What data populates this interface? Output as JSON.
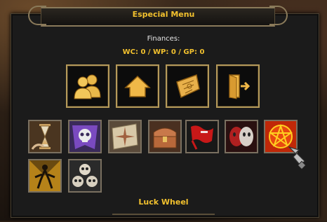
{
  "window": {
    "title": "Especial Menu"
  },
  "finances": {
    "label": "Finances:",
    "values": "WC: 0 / WP: 0 / GP: 0"
  },
  "main_buttons": [
    {
      "icon": "users-icon"
    },
    {
      "icon": "home-icon"
    },
    {
      "icon": "map-scroll-icon"
    },
    {
      "icon": "exit-door-icon"
    }
  ],
  "item_slots": [
    {
      "icon": "hourglass-icon"
    },
    {
      "icon": "skull-banner-icon"
    },
    {
      "icon": "map-icon"
    },
    {
      "icon": "treasure-chest-icon"
    },
    {
      "icon": "red-flag-icon"
    },
    {
      "icon": "masks-icon"
    },
    {
      "icon": "pentagram-icon"
    },
    {
      "icon": "glowing-figure-icon"
    },
    {
      "icon": "skulls-pile-icon"
    }
  ],
  "footer": {
    "label": "Luck Wheel"
  },
  "colors": {
    "accent": "#f2c12e",
    "panel": "#1b1b1b",
    "border": "#b59a5a"
  }
}
